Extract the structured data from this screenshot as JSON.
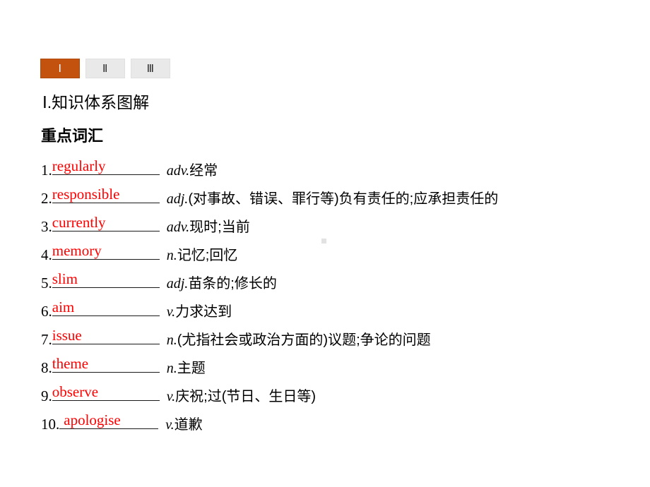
{
  "tabs": [
    {
      "label": "Ⅰ",
      "state": "active"
    },
    {
      "label": "Ⅱ",
      "state": "inactive"
    },
    {
      "label": "Ⅲ",
      "state": "inactive"
    }
  ],
  "headings": {
    "section_roman": "Ⅰ",
    "section_title": ".知识体系图解",
    "subsection_title": "重点词汇"
  },
  "vocabulary": [
    {
      "index": "1.",
      "answer": "regularly",
      "pos": "adv.",
      "meaning": "经常"
    },
    {
      "index": "2.",
      "answer": "responsible",
      "pos": "adj.",
      "meaning": "(对事故、错误、罪行等)负有责任的;应承担责任的"
    },
    {
      "index": "3.",
      "answer": "currently",
      "pos": "adv.",
      "meaning": "现时;当前"
    },
    {
      "index": "4.",
      "answer": "memory",
      "pos": "n.",
      "meaning": "记忆;回忆"
    },
    {
      "index": "5.",
      "answer": "slim",
      "pos": "adj.",
      "meaning": "苗条的;修长的"
    },
    {
      "index": "6.",
      "answer": "aim",
      "pos": "v.",
      "meaning": "力求达到"
    },
    {
      "index": "7.",
      "answer": "issue",
      "pos": "n.",
      "meaning": "(尤指社会或政治方面的)议题;争论的问题"
    },
    {
      "index": "8.",
      "answer": "theme",
      "pos": "n.",
      "meaning": "主题"
    },
    {
      "index": "9.",
      "answer": "observe",
      "pos": "v.",
      "meaning": "庆祝;过(节日、生日等)"
    },
    {
      "index": "10.",
      "answer": "apologise",
      "pos": "v.",
      "meaning": "道歉"
    }
  ],
  "colors": {
    "active_tab_background": "#c4520f",
    "active_tab_text": "#ffffff",
    "inactive_tab_background": "#e9e9e9",
    "answer_text": "#ff0000",
    "page_background": "#ffffff"
  }
}
